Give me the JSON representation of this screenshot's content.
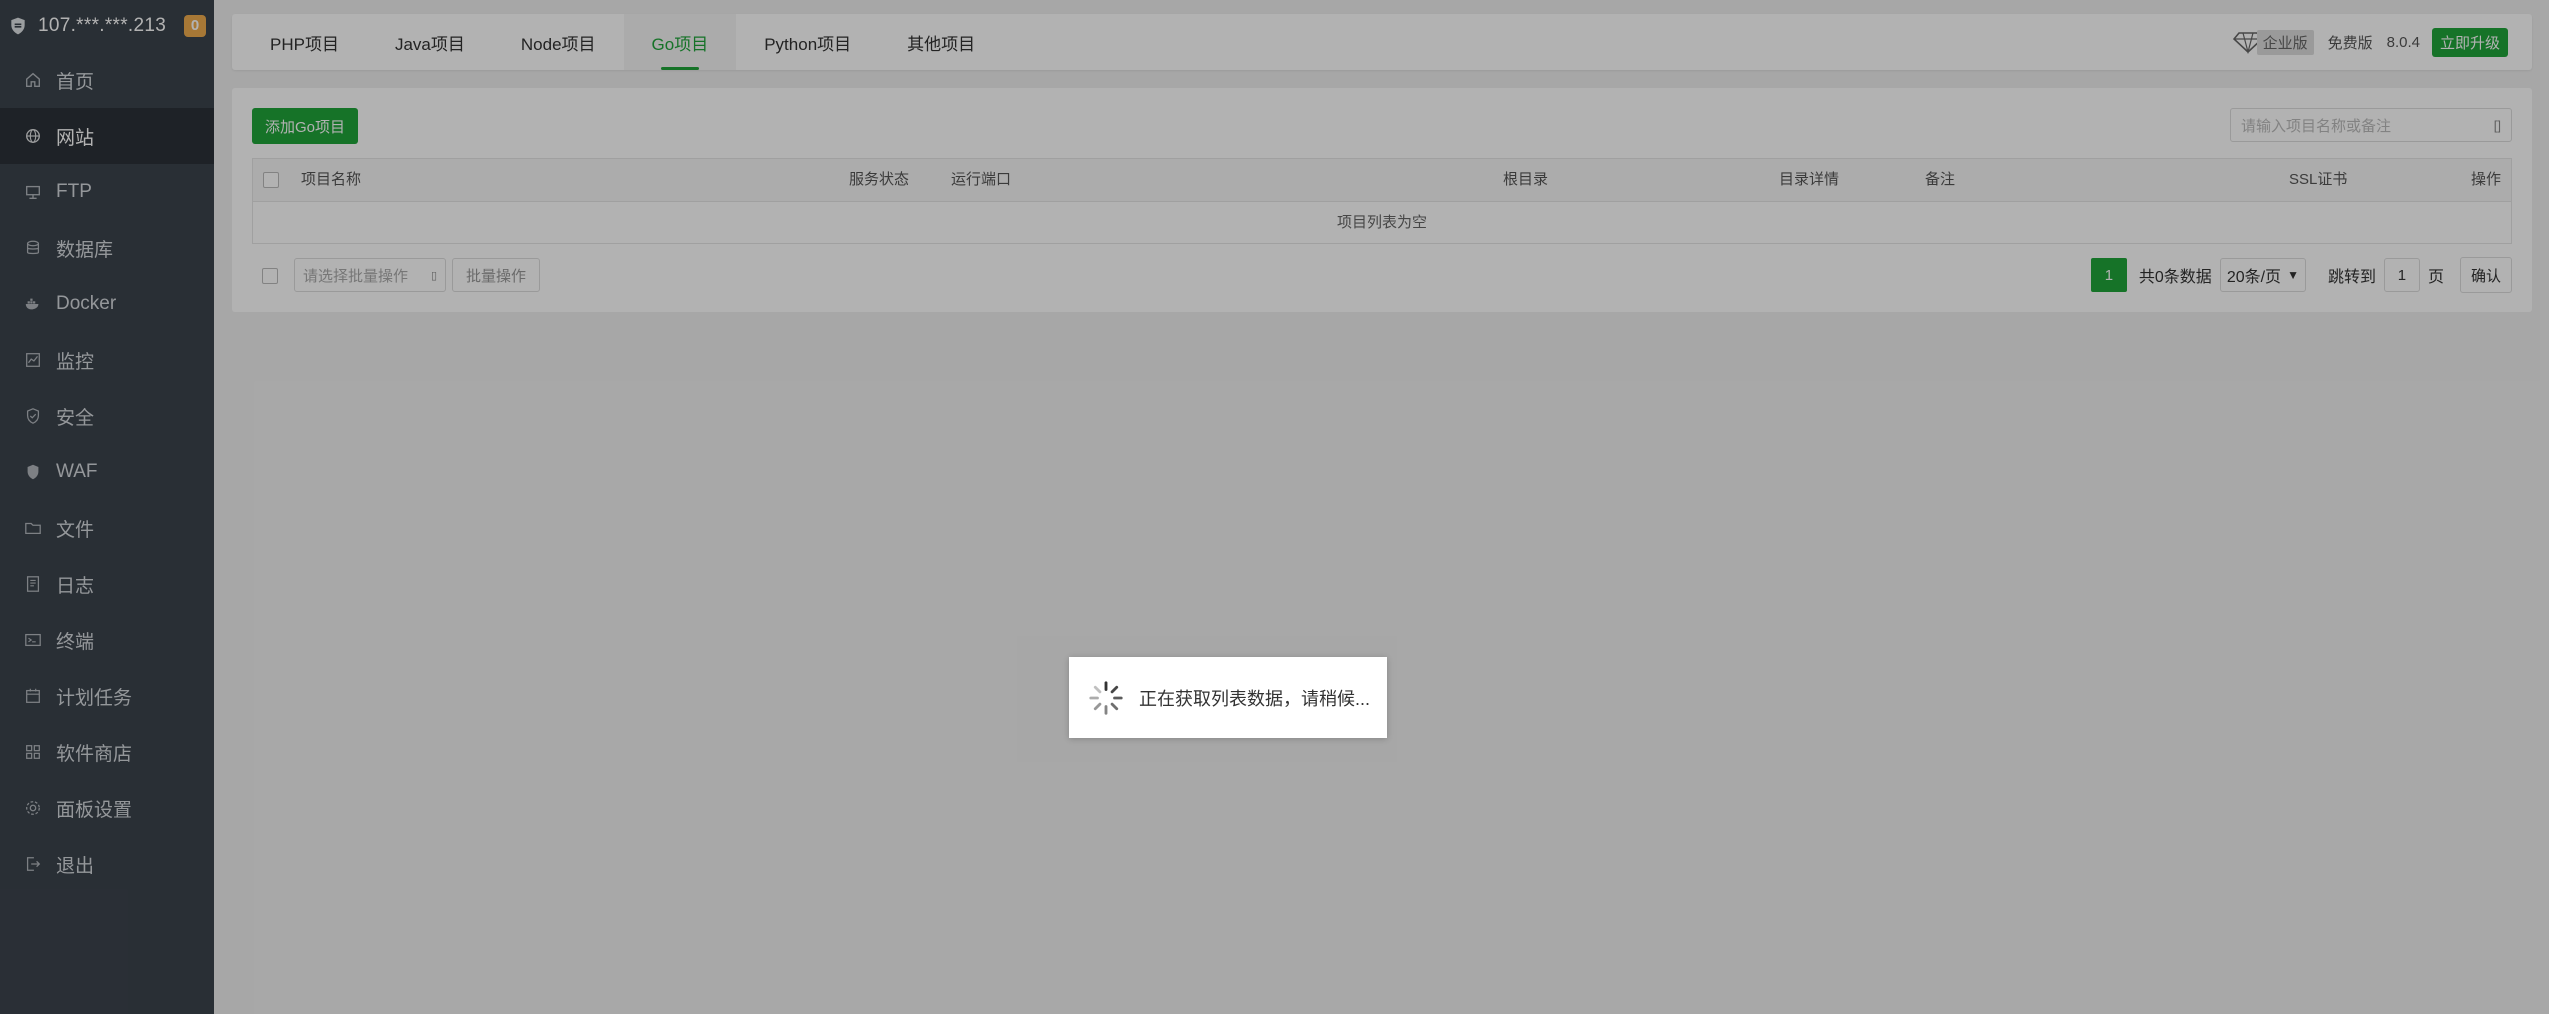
{
  "sidebar": {
    "server_ip": "107.***.***.213",
    "badge_count": "0",
    "items": [
      {
        "label": "首页",
        "icon": "home-icon"
      },
      {
        "label": "网站",
        "icon": "globe-icon"
      },
      {
        "label": "FTP",
        "icon": "ftp-icon"
      },
      {
        "label": "数据库",
        "icon": "database-icon"
      },
      {
        "label": "Docker",
        "icon": "docker-icon"
      },
      {
        "label": "监控",
        "icon": "monitor-icon"
      },
      {
        "label": "安全",
        "icon": "shield-icon"
      },
      {
        "label": "WAF",
        "icon": "waf-shield-icon"
      },
      {
        "label": "文件",
        "icon": "folder-icon"
      },
      {
        "label": "日志",
        "icon": "log-icon"
      },
      {
        "label": "终端",
        "icon": "terminal-icon"
      },
      {
        "label": "计划任务",
        "icon": "calendar-icon"
      },
      {
        "label": "软件商店",
        "icon": "apps-grid-icon"
      },
      {
        "label": "面板设置",
        "icon": "gear-icon"
      },
      {
        "label": "退出",
        "icon": "logout-icon"
      }
    ]
  },
  "tabs": [
    {
      "label": "PHP项目"
    },
    {
      "label": "Java项目"
    },
    {
      "label": "Node项目"
    },
    {
      "label": "Go项目"
    },
    {
      "label": "Python项目"
    },
    {
      "label": "其他项目"
    }
  ],
  "topbar": {
    "enterprise_label": "企业版",
    "free_label": "免费版",
    "version": "8.0.4",
    "upgrade_label": "立即升级"
  },
  "toolbar": {
    "add_label": "添加Go项目",
    "search_placeholder": "请输入项目名称或备注",
    "search_icon_glyph": "[]"
  },
  "table": {
    "headers": [
      "项目名称",
      "服务状态",
      "运行端口",
      "根目录",
      "目录详情",
      "备注",
      "SSL证书",
      "操作"
    ],
    "empty_text": "项目列表为空"
  },
  "footer": {
    "batch_placeholder": "请选择批量操作",
    "batch_button": "批量操作",
    "current_page": "1",
    "total_text": "共0条数据",
    "page_size": "20条/页",
    "jump_label": "跳转到",
    "jump_value": "1",
    "page_unit": "页",
    "confirm_label": "确认"
  },
  "loading": {
    "text": "正在获取列表数据，请稍候..."
  },
  "colors": {
    "accent": "#20a53a",
    "sidebar_bg": "#3c444d",
    "badge": "#f0ad4e"
  }
}
